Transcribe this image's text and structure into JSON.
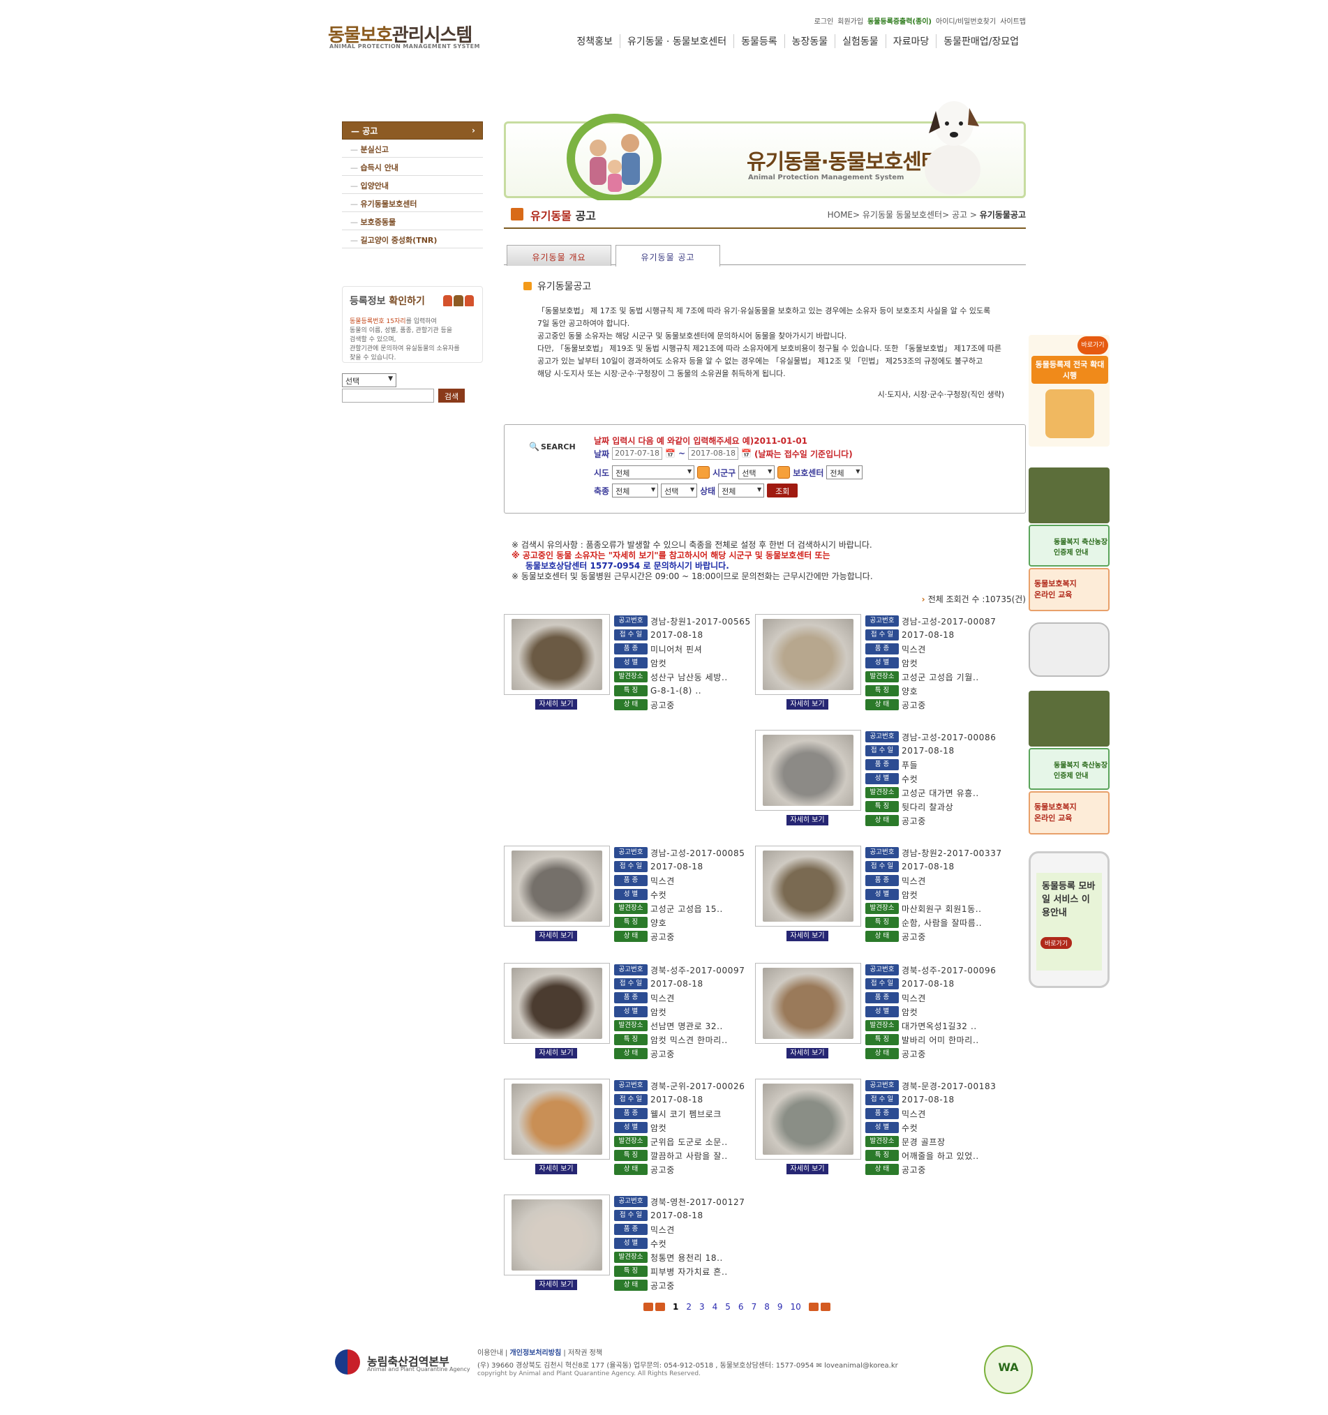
{
  "site": {
    "title_ko": "동물보호관리시스템",
    "title_ko_1": "동물보호",
    "title_ko_2": "관리시스템",
    "title_en": "ANIMAL PROTECTION MANAGEMENT SYSTEM"
  },
  "util": [
    "로그인",
    "회원가입",
    "동물등록증출력(종이)",
    "아이디/비밀번호찾기",
    "사이트맵"
  ],
  "gnb": [
    "정책홍보",
    "유기동물 · 동물보호센터",
    "동물등록",
    "농장동물",
    "실험동물",
    "자료마당",
    "동물판매업/장묘업"
  ],
  "lnb": {
    "top": "공고",
    "items": [
      "분실신고",
      "습득시 안내",
      "입양안내",
      "유기동물보호센터",
      "보호중동물",
      "길고양이 중성화(TNR)"
    ]
  },
  "reg": {
    "title_1": "등록정보 ",
    "title_2": "확인하기",
    "line1_hl": "동물등록번호 15자리",
    "line1_rest": "를 입력하여",
    "line2": "동물의 이름, 성별, 품종, 관할기관 등을",
    "line3": "검색할 수 있으며,",
    "line4": "관할기관에 문의하여 유실동물의 소유자를",
    "line5": "찾을 수 있습니다.",
    "select": "선택",
    "button": "검색"
  },
  "banner": {
    "title": "유기동물·동물보호센터",
    "subtitle": "Animal Protection Management System"
  },
  "page": {
    "title_1": "유기동물",
    "title_2": " 공고",
    "crumb": "HOME> 유기동물 동물보호센터> 공고 >",
    "crumb_cur": "유기동물공고"
  },
  "tabs": {
    "t1": "유기동물 개요",
    "t2": "유기동물 공고"
  },
  "section": {
    "heading": "유기동물공고",
    "p1": "「동물보호법」 제 17조 및 동법 시행규칙 제 7조에 따라 유기·유실동물을 보호하고 있는 경우에는 소유자 등이 보호조치 사실을 알 수 있도록",
    "p2": "7일 동안 공고하여야 합니다.",
    "p3": "공고중인 동물 소유자는 해당 시군구 및 동물보호센터에 문의하시어 동물을 찾아가시기 바랍니다.",
    "p4": "다만, 「동물보호법」 제19조 및 동법 시행규칙 제21조에 따라 소유자에게 보호비용이 청구될 수 있습니다. 또한 「동물보호법」 제17조에 따른",
    "p5": "공고가 있는 날부터 10일이 경과하여도 소유자 등을 알 수 없는 경우에는 「유실물법」 제12조 및 「민법」 제253조의 규정에도 불구하고",
    "p6": "해당 시·도지사 또는 시장·군수·구청장이 그 동물의 소유권을 취득하게 됩니다.",
    "sign": "시·도지사, 시장·군수·구청장(직인 생략)"
  },
  "search": {
    "label": "SEARCH",
    "hint": "날짜 입력시 다음 예 와같이 입력해주세요 예)2011-01-01",
    "date_label": "날짜",
    "date_from": "2017-07-18",
    "tilde": "~",
    "date_to": "2017-08-18",
    "date_note": "(날짜는 접수일 기준입니다)",
    "sido_label": "시도",
    "sido_val": "전체",
    "sigungu_label": "시군구",
    "sigungu_val": "선택",
    "center_label": "보호센터",
    "center_val": "전체",
    "kind_label": "축종",
    "kind_val": "전체",
    "breed_val": "선택",
    "state_label": "상태",
    "state_val": "전체",
    "btn": "조회"
  },
  "warn": {
    "l1": "※ 검색시 유의사항 : 품종오류가 발생할 수 있으니 축종을 전체로 설정 후 한번 더 검색하시기 바랍니다.",
    "l2": "※ 공고중인 동물 소유자는 \"자세히 보기\"를 참고하시어 해당 시군구 및 동물보호센터 또는",
    "l3": "동물보호상담센터 1577-0954 로 문의하시기 바랍니다.",
    "l4": "※ 동물보호센터 및 동물병원 근무시간은 09:00 ~ 18:00이므로 문의전화는 근무시간에만 가능합니다."
  },
  "total": "전체 조회건 수 :10735(건)",
  "labels": {
    "no": "공고번호",
    "date": "접 수 일",
    "breed": "품 종",
    "sex": "성 별",
    "place": "발견장소",
    "feat": "특 징",
    "state": "상 태",
    "detail": "자세히 보기"
  },
  "cards": [
    {
      "no": "경남-창원1-2017-00565",
      "date": "2017-08-18",
      "breed": "미니어처 핀셔",
      "sex": "암컷",
      "place": "성산구 남산동 세방..",
      "feat": "G-8-1-(8) ..",
      "state": "공고중",
      "color": "#6b5a44"
    },
    {
      "no": "경남-고성-2017-00087",
      "date": "2017-08-18",
      "breed": "믹스견",
      "sex": "암컷",
      "place": "고성군 고성읍 기월..",
      "feat": "양호",
      "state": "공고중",
      "color": "#b7a78e"
    },
    {
      "no": "경남-고성-2017-00086",
      "date": "2017-08-18",
      "breed": "푸들",
      "sex": "수컷",
      "place": "고성군 대가면 유흥..",
      "feat": "뒷다리 찰과상",
      "state": "공고중",
      "color": "#8c8a86"
    },
    {
      "no": "경남-고성-2017-00085",
      "date": "2017-08-18",
      "breed": "믹스견",
      "sex": "수컷",
      "place": "고성군 고성읍 15..",
      "feat": "양호",
      "state": "공고중",
      "color": "#75706a"
    },
    {
      "no": "경남-창원2-2017-00337",
      "date": "2017-08-18",
      "breed": "믹스견",
      "sex": "암컷",
      "place": "마산회원구 회원1동..",
      "feat": "순함, 사람을 잘따름..",
      "state": "공고중",
      "color": "#7a6a52"
    },
    {
      "no": "경북-성주-2017-00097",
      "date": "2017-08-18",
      "breed": "믹스견",
      "sex": "암컷",
      "place": "선남면 명관로 32..",
      "feat": "암컷 믹스견 한마리..",
      "state": "공고중",
      "color": "#4b3c30"
    },
    {
      "no": "경북-성주-2017-00096",
      "date": "2017-08-18",
      "breed": "믹스견",
      "sex": "암컷",
      "place": "대가면옥성1길32 ..",
      "feat": "발바리 어미 한마리..",
      "state": "공고중",
      "color": "#9a7a5a"
    },
    {
      "no": "경북-군위-2017-00026",
      "date": "2017-08-18",
      "breed": "웰시 코기 펨브로크",
      "sex": "암컷",
      "place": "군위읍 도군로 소문..",
      "feat": "깔끔하고 사람을 잘..",
      "state": "공고중",
      "color": "#c98f55"
    },
    {
      "no": "경북-문경-2017-00183",
      "date": "2017-08-18",
      "breed": "믹스견",
      "sex": "수컷",
      "place": "문경 골프장",
      "feat": "어깨줄을 하고 있었..",
      "state": "공고중",
      "color": "#8a8e86"
    },
    {
      "no": "경북-영천-2017-00127",
      "date": "2017-08-18",
      "breed": "믹스견",
      "sex": "수컷",
      "place": "청통면 용천리 18..",
      "feat": "피부병 자가치료 흔..",
      "state": "공고중",
      "color": "#d6cdc3"
    }
  ],
  "pager": {
    "current": "1",
    "pages": [
      "2",
      "3",
      "4",
      "5",
      "6",
      "7",
      "8",
      "9",
      "10"
    ]
  },
  "right": {
    "b1": "동물등록제 전국 확대시행",
    "b1_go": "바로가기",
    "b2": "동물복지 축산농장 인증제 안내",
    "b3": "동물보호복지 온라인 교육",
    "b4": "동물등록 모바일 서비스 이용안내",
    "b4_go": "바로가기"
  },
  "footer": {
    "org": "농림축산검역본부",
    "org_en": "Animal and Plant Quarantine Agency",
    "link1": "이용안내",
    "link2": "개인정보처리방침",
    "link3": "저작권 정책",
    "addr": "(우) 39660  경상북도 김천시 혁신8로 177 (율곡동)  업무문의: 054-912-0518 ,  동물보호상담센터: 1577-0954",
    "email": "loveanimal@korea.kr",
    "copy": "copyright by Animal and Plant Quarantine Agency. All Rights Reserved.",
    "wa": "WA"
  }
}
